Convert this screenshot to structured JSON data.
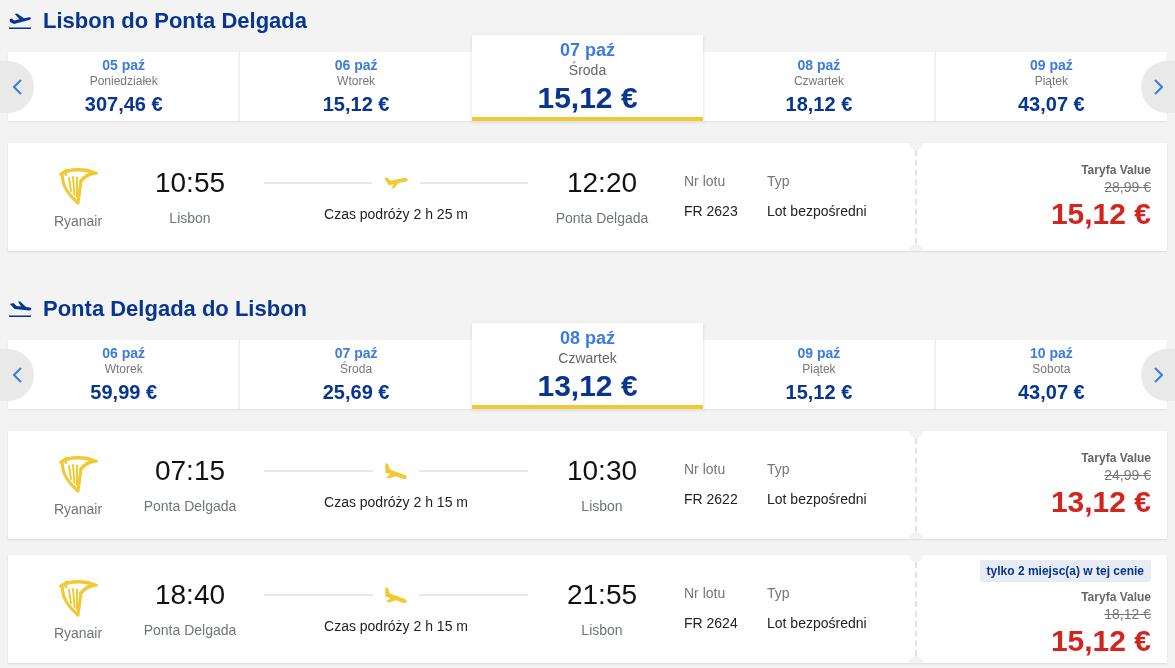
{
  "sections": [
    {
      "title": "Lisbon do Ponta Delgada",
      "kind": "outbound",
      "dates": [
        {
          "date": "05 paź",
          "weekday": "Poniedziałek",
          "price": "307,46 €",
          "selected": false
        },
        {
          "date": "06 paź",
          "weekday": "Wtorek",
          "price": "15,12 €",
          "selected": false
        },
        {
          "date": "07 paź",
          "weekday": "Środa",
          "price": "15,12 €",
          "selected": true
        },
        {
          "date": "08 paź",
          "weekday": "Czwartek",
          "price": "18,12 €",
          "selected": false
        },
        {
          "date": "09 paź",
          "weekday": "Piątek",
          "price": "43,07 €",
          "selected": false
        }
      ],
      "flights": [
        {
          "airline": "Ryanair",
          "departure_time": "10:55",
          "departure_city": "Lisbon",
          "duration": "Czas podróży 2 h 25 m",
          "arrival_time": "12:20",
          "arrival_city": "Ponta Delgada",
          "flight_number_label": "Nr lotu",
          "flight_number": "FR 2623",
          "type_label": "Typ",
          "type": "Lot bezpośredni",
          "fare_name": "Taryfa Value",
          "old_price": "28,99 €",
          "price": "15,12 €"
        }
      ]
    },
    {
      "title": "Ponta Delgada do Lisbon",
      "kind": "return",
      "dates": [
        {
          "date": "06 paź",
          "weekday": "Wtorek",
          "price": "59,99 €",
          "selected": false
        },
        {
          "date": "07 paź",
          "weekday": "Środa",
          "price": "25,69 €",
          "selected": false
        },
        {
          "date": "08 paź",
          "weekday": "Czwartek",
          "price": "13,12 €",
          "selected": true
        },
        {
          "date": "09 paź",
          "weekday": "Piątek",
          "price": "15,12 €",
          "selected": false
        },
        {
          "date": "10 paź",
          "weekday": "Sobota",
          "price": "43,07 €",
          "selected": false
        }
      ],
      "flights": [
        {
          "airline": "Ryanair",
          "departure_time": "07:15",
          "departure_city": "Ponta Delgada",
          "duration": "Czas podróży 2 h 15 m",
          "arrival_time": "10:30",
          "arrival_city": "Lisbon",
          "flight_number_label": "Nr lotu",
          "flight_number": "FR 2622",
          "type_label": "Typ",
          "type": "Lot bezpośredni",
          "fare_name": "Taryfa Value",
          "old_price": "24,99 €",
          "price": "13,12 €"
        },
        {
          "airline": "Ryanair",
          "departure_time": "18:40",
          "departure_city": "Ponta Delgada",
          "duration": "Czas podróży 2 h 15 m",
          "arrival_time": "21:55",
          "arrival_city": "Lisbon",
          "flight_number_label": "Nr lotu",
          "flight_number": "FR 2624",
          "type_label": "Typ",
          "type": "Lot bezpośredni",
          "badge": "tylko 2 miejsc(a) w tej cenie",
          "fare_name": "Taryfa Value",
          "old_price": "18,12 €",
          "price": "15,12 €"
        }
      ]
    }
  ]
}
